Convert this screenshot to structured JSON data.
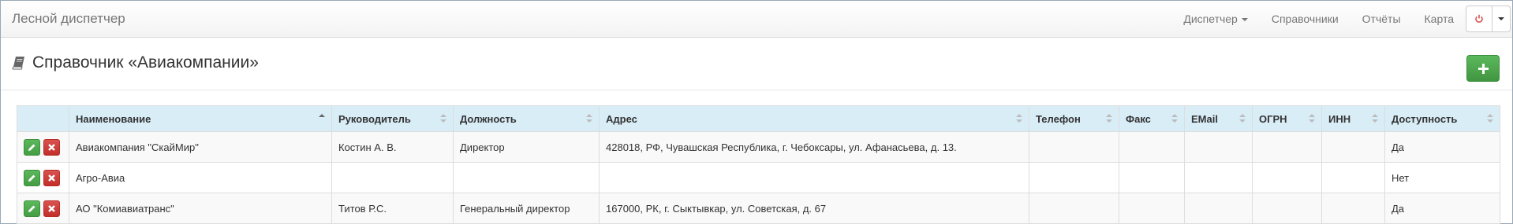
{
  "navbar": {
    "brand": "Лесной диспетчер",
    "links": [
      "Диспетчер",
      "Справочники",
      "Отчёты",
      "Карта"
    ]
  },
  "page": {
    "title": "Справочник «Авиакомпании»"
  },
  "table": {
    "columns": [
      "Наименование",
      "Руководитель",
      "Должность",
      "Адрес",
      "Телефон",
      "Факс",
      "EMail",
      "ОГРН",
      "ИНН",
      "Доступность"
    ],
    "rows": [
      {
        "name": "Авиакомпания \"СкайМир\"",
        "head": "Костин А. В.",
        "position": "Директор",
        "address": "428018, РФ, Чувашская Республика, г. Чебоксары, ул. Афанасьева, д. 13.",
        "phone": "",
        "fax": "",
        "email": "",
        "ogrn": "",
        "inn": "",
        "availability": "Да"
      },
      {
        "name": "Агро-Авиа",
        "head": "",
        "position": "",
        "address": "",
        "phone": "",
        "fax": "",
        "email": "",
        "ogrn": "",
        "inn": "",
        "availability": "Нет"
      },
      {
        "name": "АО \"Комиавиатранс\"",
        "head": "Титов Р.С.",
        "position": "Генеральный директор",
        "address": "167000, РК, г. Сыктывкар, ул. Советская, д. 67",
        "phone": "",
        "fax": "",
        "email": "",
        "ogrn": "",
        "inn": "",
        "availability": "Да"
      }
    ]
  },
  "colors": {
    "header_bg": "#d9edf7",
    "success": "#5cb85c",
    "danger": "#d9534f"
  }
}
